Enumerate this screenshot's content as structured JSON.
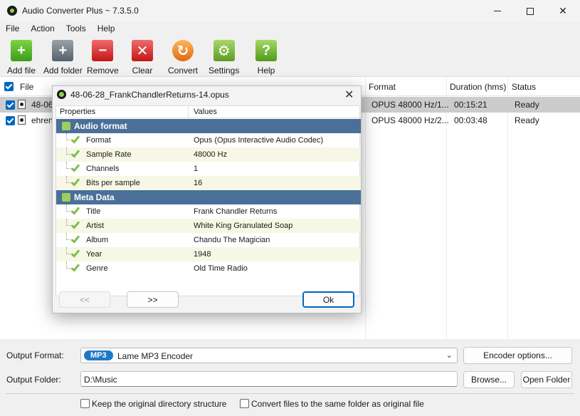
{
  "window": {
    "title": "Audio Converter Plus ~ 7.3.5.0"
  },
  "menu": [
    "File",
    "Action",
    "Tools",
    "Help"
  ],
  "toolbar": [
    {
      "label": "Add file",
      "icon": "add-file-icon"
    },
    {
      "label": "Add folder",
      "icon": "add-folder-icon"
    },
    {
      "label": "Remove",
      "icon": "remove-icon"
    },
    {
      "label": "Clear",
      "icon": "clear-icon"
    },
    {
      "label": "Convert",
      "icon": "convert-icon"
    },
    {
      "label": "Settings",
      "icon": "gear-icon"
    },
    {
      "label": "Help",
      "icon": "help-icon"
    }
  ],
  "list": {
    "columns": {
      "file": "File",
      "format": "Format",
      "duration": "Duration (hms)",
      "status": "Status"
    },
    "rows": [
      {
        "file": "48-06",
        "format": "OPUS 48000 Hz/1...",
        "duration": "00:15:21",
        "status": "Ready",
        "selected": true
      },
      {
        "file": "ehren",
        "format": "OPUS 48000 Hz/2...",
        "duration": "00:03:48",
        "status": "Ready",
        "selected": false
      }
    ]
  },
  "output": {
    "format_label": "Output Format:",
    "format_badge": "MP3",
    "format_value": "Lame MP3 Encoder",
    "encoder_options": "Encoder options...",
    "folder_label": "Output Folder:",
    "folder_value": "D:\\Music",
    "browse": "Browse...",
    "open_folder": "Open Folder",
    "keep_structure": "Keep the original directory structure",
    "same_folder": "Convert files to the same folder as original file"
  },
  "dialog": {
    "title": "48-06-28_FrankChandlerReturns-14.opus",
    "col_properties": "Properties",
    "col_values": "Values",
    "sections": [
      {
        "name": "Audio format",
        "items": [
          {
            "k": "Format",
            "v": "Opus (Opus Interactive Audio Codec)"
          },
          {
            "k": "Sample Rate",
            "v": "48000 Hz"
          },
          {
            "k": "Channels",
            "v": "1"
          },
          {
            "k": "Bits per sample",
            "v": "16"
          }
        ]
      },
      {
        "name": "Meta Data",
        "items": [
          {
            "k": "Title",
            "v": "Frank Chandler Returns"
          },
          {
            "k": "Artist",
            "v": "White King Granulated Soap"
          },
          {
            "k": "Album",
            "v": "Chandu The Magician"
          },
          {
            "k": "Year",
            "v": "1948"
          },
          {
            "k": "Genre",
            "v": "Old Time Radio"
          }
        ]
      }
    ],
    "prev": "<<",
    "next": ">>",
    "ok": "Ok"
  }
}
